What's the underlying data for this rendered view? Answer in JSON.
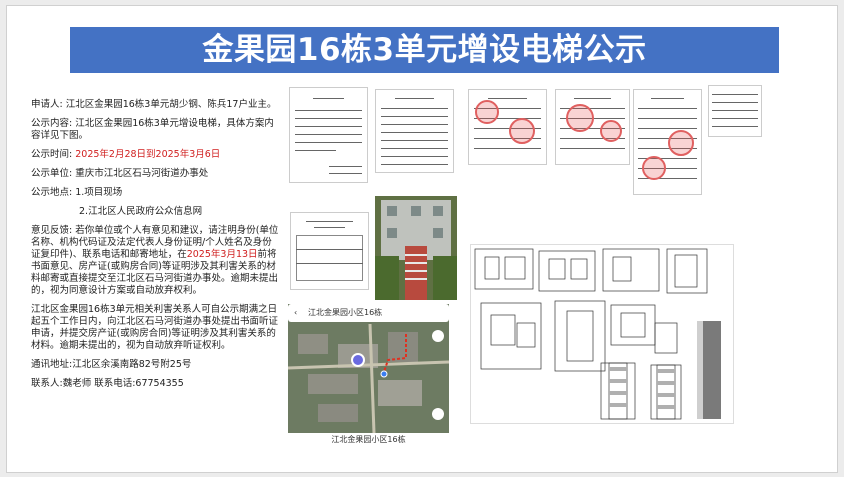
{
  "title": "金果园16栋3单元增设电梯公示",
  "lines": {
    "applicant": "申请人: 江北区金果园16栋3单元胡少钢、陈兵17户业主。",
    "content": "公示内容: 江北区金果园16栋3单元增设电梯，具体方案内容详见下图。",
    "period_label": "公示时间: ",
    "period_value": "2025年2月28日到2025年3月6日",
    "unit": "公示单位: 重庆市江北区石马河街道办事处",
    "location1": "公示地点: 1.项目现场",
    "location2": "2.江北区人民政府公众信息网",
    "feedback_a": "意见反馈: 若你单位或个人有意见和建议，请注明身份(单位名称、机构代码证及法定代表人身份证明/个人姓名及身份证复印件)、联系电话和邮寄地址，在",
    "feedback_date": "2025年3月13日",
    "feedback_b": "前将书面意见、房产证(或购房合同)等证明涉及其利害关系的材料邮寄或直接提交至江北区石马河街道办事处。逾期未提出的，视为同意设计方案或自动放弃权利。",
    "hearing": "江北区金果园16栋3单元相关利害关系人可自公示期满之日起五个工作日内，向江北区石马河街道办事处提出书面听证申请，并提交房产证(或购房合同)等证明涉及其利害关系的材料。逾期未提出的，视为自动放弃听证权利。",
    "address": "通讯地址:江北区余溪南路82号附25号",
    "contact": "联系人:魏老师    联系电话:67754355"
  },
  "map": {
    "search_text": "江北金果园小区16栋",
    "caption": "江北金果园小区16栋"
  },
  "colors": {
    "banner": "#4472c4",
    "highlight": "#d02020"
  }
}
